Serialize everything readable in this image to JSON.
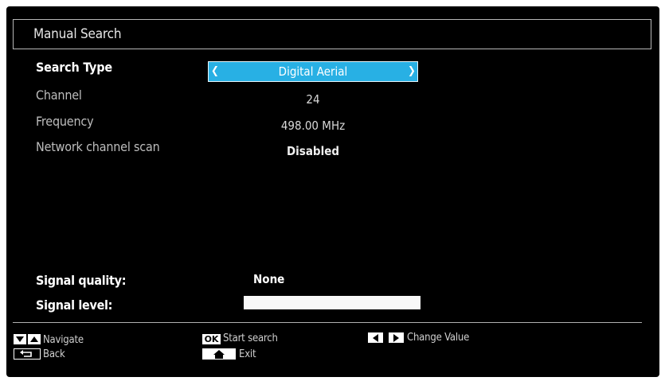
{
  "header": {
    "title": "Manual Search"
  },
  "fields": {
    "search_type": {
      "label": "Search Type",
      "value": "Digital Aerial"
    },
    "channel": {
      "label": "Channel",
      "value": "24"
    },
    "frequency": {
      "label": "Frequency",
      "value": "498.00 MHz"
    },
    "network_scan": {
      "label": "Network channel scan",
      "value": "Disabled"
    }
  },
  "signal": {
    "quality_label": "Signal quality:",
    "quality_value": "None",
    "level_label": "Signal level:"
  },
  "footer": {
    "navigate": "Navigate",
    "back": "Back",
    "ok_key": "OK",
    "start_search": "Start search",
    "exit": "Exit",
    "change_value": "Change Value"
  },
  "colors": {
    "selector": "#28b0e4",
    "background": "#000000"
  },
  "icons": [
    "left-arrow-icon",
    "right-arrow-icon",
    "down-arrow-icon",
    "up-arrow-icon",
    "back-icon",
    "home-icon"
  ]
}
